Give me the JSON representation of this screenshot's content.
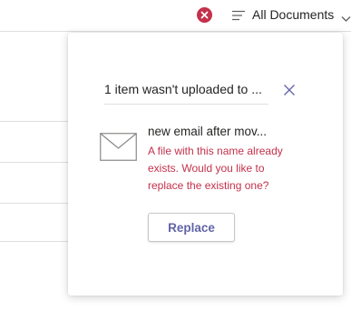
{
  "header": {
    "status_icon": "error-circle-icon",
    "view_icon": "list-lines-icon",
    "view_label": "All Documents",
    "chevron_icon": "chevron-down-icon",
    "error_color": "#c4314b"
  },
  "upload_panel": {
    "heading": "1 item wasn't uploaded to ...",
    "close_icon": "close-icon",
    "items": [
      {
        "file_icon": "email-envelope-icon",
        "file_name": "new email after mov...",
        "error_message": "A file with this name already exists. Would you like to replace the existing one?",
        "action_label": "Replace"
      }
    ],
    "accent_color": "#6264a7"
  }
}
